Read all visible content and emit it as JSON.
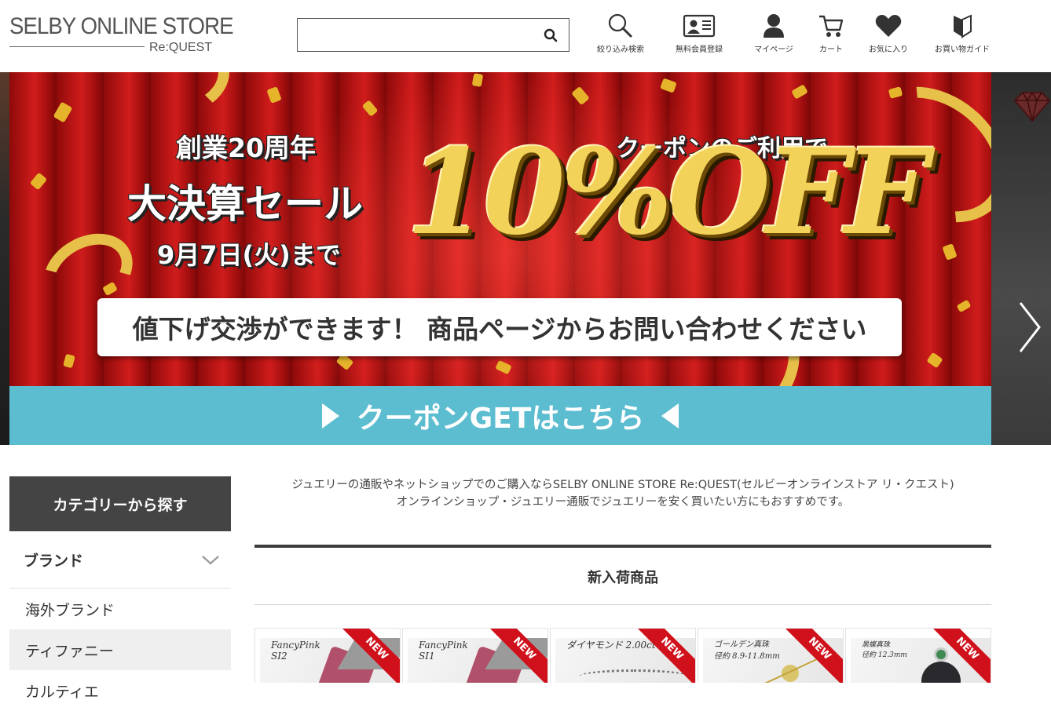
{
  "header": {
    "logo_main": "SELBY ONLINE STORE",
    "logo_sub": "Re:QUEST",
    "search_placeholder": "",
    "nav": [
      {
        "label": "絞り込み検索",
        "icon": "search-icon"
      },
      {
        "label": "無料会員登録",
        "icon": "member-card-icon"
      },
      {
        "label": "マイページ",
        "icon": "user-icon"
      },
      {
        "label": "カート",
        "icon": "cart-icon"
      },
      {
        "label": "お気に入り",
        "icon": "heart-icon"
      },
      {
        "label": "お買い物ガイド",
        "icon": "guide-icon"
      }
    ]
  },
  "banner": {
    "line1": "創業20周年",
    "line2": "大決算セール",
    "line3": "9月7日(火)まで",
    "coupon_text": "クーポンのご利用で",
    "discount": "10%OFF",
    "strip_text": "値下げ交渉ができます！ 商品ページからお問い合わせください",
    "cta_text": "クーポンGETはこちら"
  },
  "sidebar": {
    "heading": "カテゴリーから探す",
    "brand_label": "ブランド",
    "items": [
      "海外ブランド",
      "ティファニー",
      "カルティエ"
    ]
  },
  "main": {
    "intro_line1": "ジュエリーの通販やネットショップでのご購入ならSELBY ONLINE STORE Re:QUEST(セルビーオンラインストア リ・クエスト)",
    "intro_line2": "オンラインショップ・ジュエリー通販でジュエリーを安く買いたい方にもおすすめです。",
    "section_title": "新入荷商品",
    "new_badge": "NEW",
    "products": [
      {
        "cap1": "FancyPink",
        "cap2": "SI2"
      },
      {
        "cap1": "FancyPink",
        "cap2": "SI1"
      },
      {
        "cap1": "ダイヤモンド 2.00ct",
        "cap2": ""
      },
      {
        "cap1": "ゴールデン真珠",
        "cap2": "径約 8.9-11.8mm"
      },
      {
        "cap1": "黒蝶真珠",
        "cap2": "径約 12.3mm"
      }
    ]
  },
  "colors": {
    "accent_cta": "#5cbdd0",
    "new_ribbon": "#d0101a",
    "dark_header": "#444444"
  }
}
